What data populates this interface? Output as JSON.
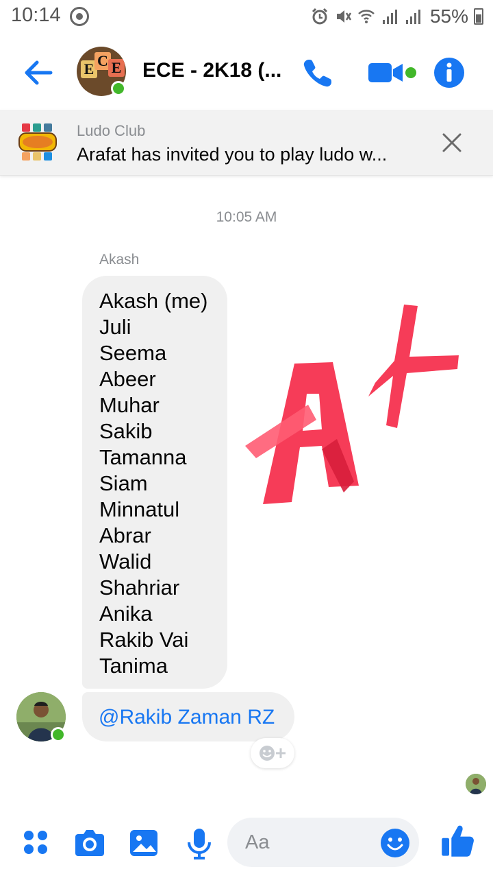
{
  "status_bar": {
    "time": "10:14",
    "battery": "55%"
  },
  "header": {
    "title": "ECE - 2K18 (...",
    "group_avatar_letters": [
      "E",
      "C",
      "E"
    ]
  },
  "game_banner": {
    "title": "Ludo Club",
    "text": "Arafat has invited you to play ludo w..."
  },
  "chat": {
    "timestamp": "10:05 AM",
    "sender_name": "Akash",
    "message_lines": [
      "Akash (me)",
      "Juli",
      "Seema",
      "Abeer",
      "Muhar",
      "Sakib",
      "Tamanna",
      "Siam",
      "Minnatul",
      "Abrar",
      "Walid",
      "Shahriar",
      "Anika",
      "Rakib Vai",
      "Tanima"
    ],
    "mention": "@Rakib Zaman RZ"
  },
  "composer": {
    "placeholder": "Aa"
  },
  "colors": {
    "accent": "#1877f2",
    "online": "#42b72a",
    "bubble": "#f0f0f0",
    "sticker": "#f5324f"
  },
  "icons": [
    "back-arrow-icon",
    "phone-icon",
    "video-camera-icon",
    "info-icon",
    "close-icon",
    "add-reaction-icon",
    "apps-grid-icon",
    "camera-icon",
    "gallery-icon",
    "microphone-icon",
    "emoji-icon",
    "thumbs-up-icon"
  ]
}
